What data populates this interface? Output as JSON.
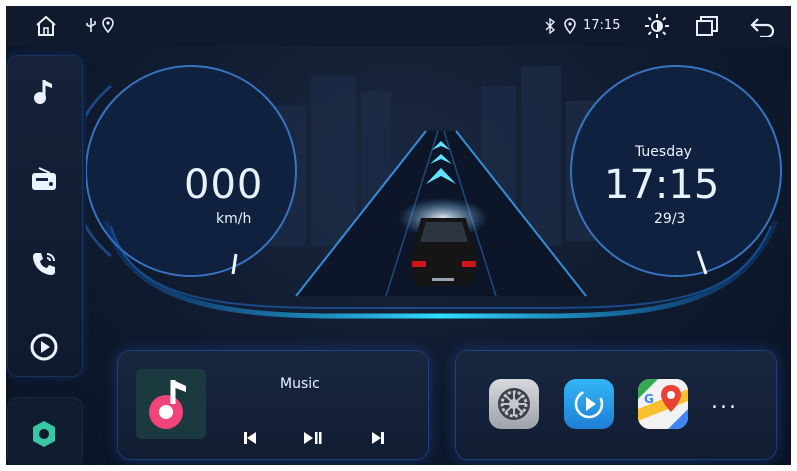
{
  "status_bar": {
    "time": "17:15",
    "icons": [
      "home-icon",
      "usb-icon",
      "location-icon",
      "bluetooth-icon",
      "location-icon",
      "brightness-icon",
      "recent-apps-icon",
      "back-icon"
    ]
  },
  "sidebar": {
    "items": [
      "music-icon",
      "radio-icon",
      "phone-icon",
      "carplay-icon",
      "settings-hex-icon"
    ]
  },
  "speed": {
    "value": "000",
    "unit": "km/h"
  },
  "clock": {
    "day": "Tuesday",
    "time": "17:15",
    "date": "29/3"
  },
  "music": {
    "title": "Music",
    "controls": [
      "previous-icon",
      "play-pause-icon",
      "next-icon"
    ]
  },
  "apps": {
    "items": [
      "settings-gear-app",
      "browser-app",
      "maps-app"
    ],
    "more": "..."
  },
  "colors": {
    "accent": "#3fd0ff",
    "cyan_glow": "#30e0ff",
    "background": "#0f1a2e",
    "music_pink": "#f0447a"
  }
}
